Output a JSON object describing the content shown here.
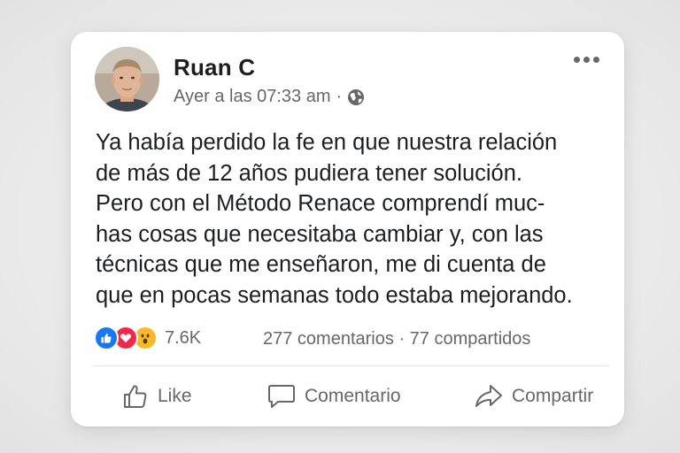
{
  "post": {
    "author": "Ruan C",
    "timestamp": "Ayer a las 07:33 am",
    "separator": "·",
    "privacy_icon": "globe-icon",
    "menu_icon": "more-options-icon",
    "text_lines": [
      "Ya había perdido la fe en que nuestra relación",
      "de más de 12 años pudiera tener solución.",
      "Pero con el Método Renace comprendí muc-",
      "has cosas que necesitaba cambiar y, con las",
      "técnicas que me enseñaron, me di cuenta de",
      "que en pocas semanas todo estaba mejorando."
    ]
  },
  "engagement": {
    "reaction_icons": [
      "like-reaction-icon",
      "love-reaction-icon",
      "wow-reaction-icon"
    ],
    "reactions_count": "7.6K",
    "comments": "277 comentarios",
    "stats_separator": "·",
    "shares": "77 compartidos"
  },
  "actions": {
    "like_label": "Like",
    "comment_label": "Comentario",
    "share_label": "Compartir"
  },
  "colors": {
    "like_blue": "#1877f2",
    "love_red": "#f0284a",
    "wow_yellow": "#f7b928",
    "secondary_text": "#65676b",
    "primary_text": "#1c1e21"
  }
}
